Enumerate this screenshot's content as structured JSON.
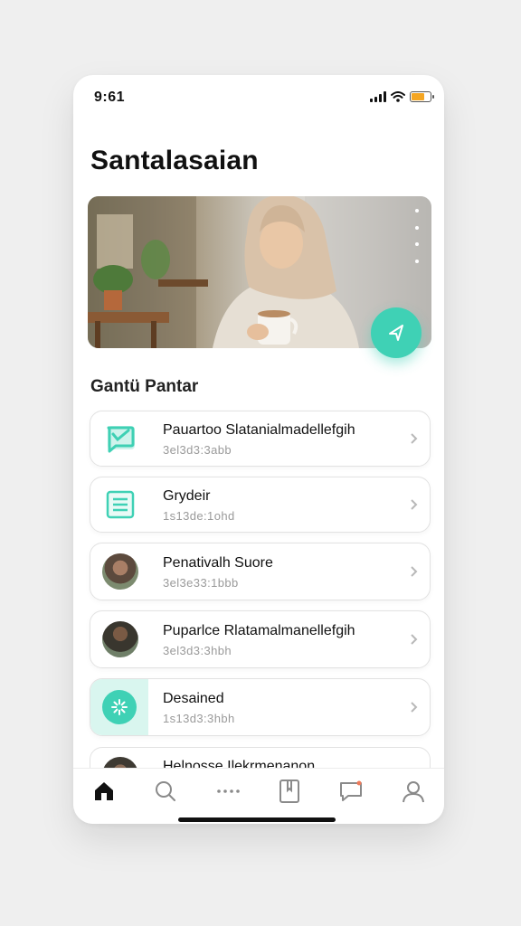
{
  "status_bar": {
    "time": "9:61"
  },
  "header": {
    "title": "Santalasaian"
  },
  "section": {
    "title": "Gantü Pantar"
  },
  "items": [
    {
      "title": "Pauartoo Slatanialmadellefgih",
      "subtitle": "3el3d3:3abb",
      "icon": "chat-check-icon"
    },
    {
      "title": "Grydeir",
      "subtitle": "1s13de:1ohd",
      "icon": "document-list-icon"
    },
    {
      "title": "Penativalh Suore",
      "subtitle": "3el3e33:1bbb",
      "icon": "avatar-photo"
    },
    {
      "title": "Puparlce Rlatamalmanellefgih",
      "subtitle": "3el3d3:3hbh",
      "icon": "avatar-photo"
    },
    {
      "title": "Desained",
      "subtitle": "1s13d3:3hbh",
      "icon": "sparkle-icon"
    },
    {
      "title": "Helnosse Ilekrmenanon",
      "subtitle": "",
      "icon": "avatar-photo"
    }
  ],
  "tabs": [
    {
      "name": "home",
      "icon": "home-icon",
      "active": true
    },
    {
      "name": "search",
      "icon": "search-icon",
      "active": false
    },
    {
      "name": "more",
      "icon": "dots-icon",
      "active": false
    },
    {
      "name": "library",
      "icon": "bookmark-book-icon",
      "active": false
    },
    {
      "name": "messages",
      "icon": "message-icon",
      "active": false
    },
    {
      "name": "profile",
      "icon": "person-icon",
      "active": false
    }
  ],
  "colors": {
    "accent": "#3fd1b5",
    "accent_light": "#d9f6ef",
    "battery": "#f5a623"
  }
}
